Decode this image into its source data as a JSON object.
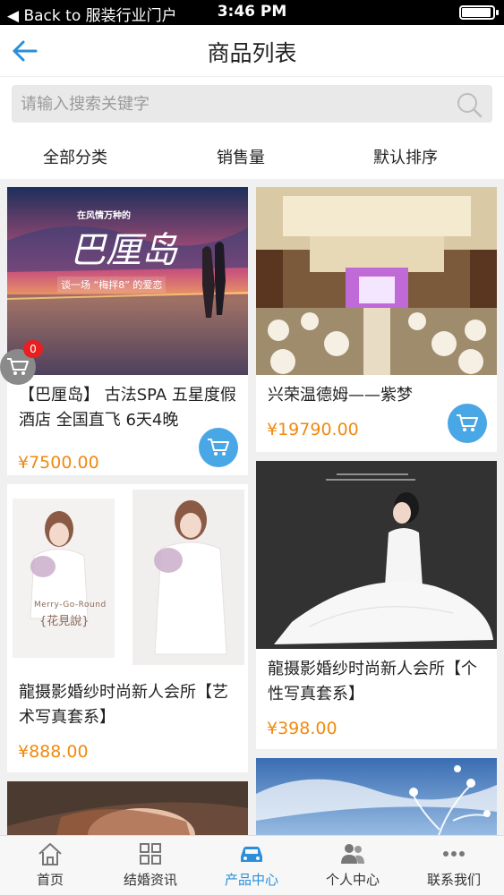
{
  "status_bar": {
    "back_text": "◀ Back to 服装行业门户",
    "time": "3:46 PM",
    "battery_level": 0.95
  },
  "header": {
    "title": "商品列表",
    "back_icon": "arrow-left-icon"
  },
  "search": {
    "placeholder": "请输入搜索关键字",
    "icon": "search-icon"
  },
  "filters": [
    {
      "label": "全部分类",
      "icon": "caret-down-icon"
    },
    {
      "label": "销售量",
      "icon": "caret-down-icon"
    },
    {
      "label": "默认排序",
      "icon": "caret-down-icon"
    }
  ],
  "products": [
    {
      "image_caption_small": "在风情万种的",
      "image_caption_big": "巴厘岛",
      "image_caption_line": "谈一场 “梅拌8” 的爱恋",
      "name": "【巴厘岛】 古法SPA 五星度假酒店 全国直飞 6天4晚",
      "price": "¥7500.00"
    },
    {
      "name": "兴荣温德姆——紫梦",
      "price": "¥19790.00"
    },
    {
      "image_caption_small": "Merry-Go-Round",
      "image_caption_big": "{花見說}",
      "name": "龍摄影婚纱时尚新人会所【艺术写真套系】",
      "price": "¥888.00"
    },
    {
      "name": "龍摄影婚纱时尚新人会所【个性写真套系】",
      "price": "¥398.00"
    }
  ],
  "cart": {
    "badge_count": "0",
    "icon": "shopping-cart-icon"
  },
  "tabbar": [
    {
      "label": "首页",
      "icon": "home-icon"
    },
    {
      "label": "结婚资讯",
      "icon": "grid-icon"
    },
    {
      "label": "产品中心",
      "icon": "car-icon",
      "active": true
    },
    {
      "label": "个人中心",
      "icon": "users-icon"
    },
    {
      "label": "联系我们",
      "icon": "more-icon"
    }
  ],
  "colors": {
    "accent": "#2a8fd8",
    "price": "#f08a10",
    "cart_button": "#4aa7e6",
    "badge": "#e62020"
  }
}
